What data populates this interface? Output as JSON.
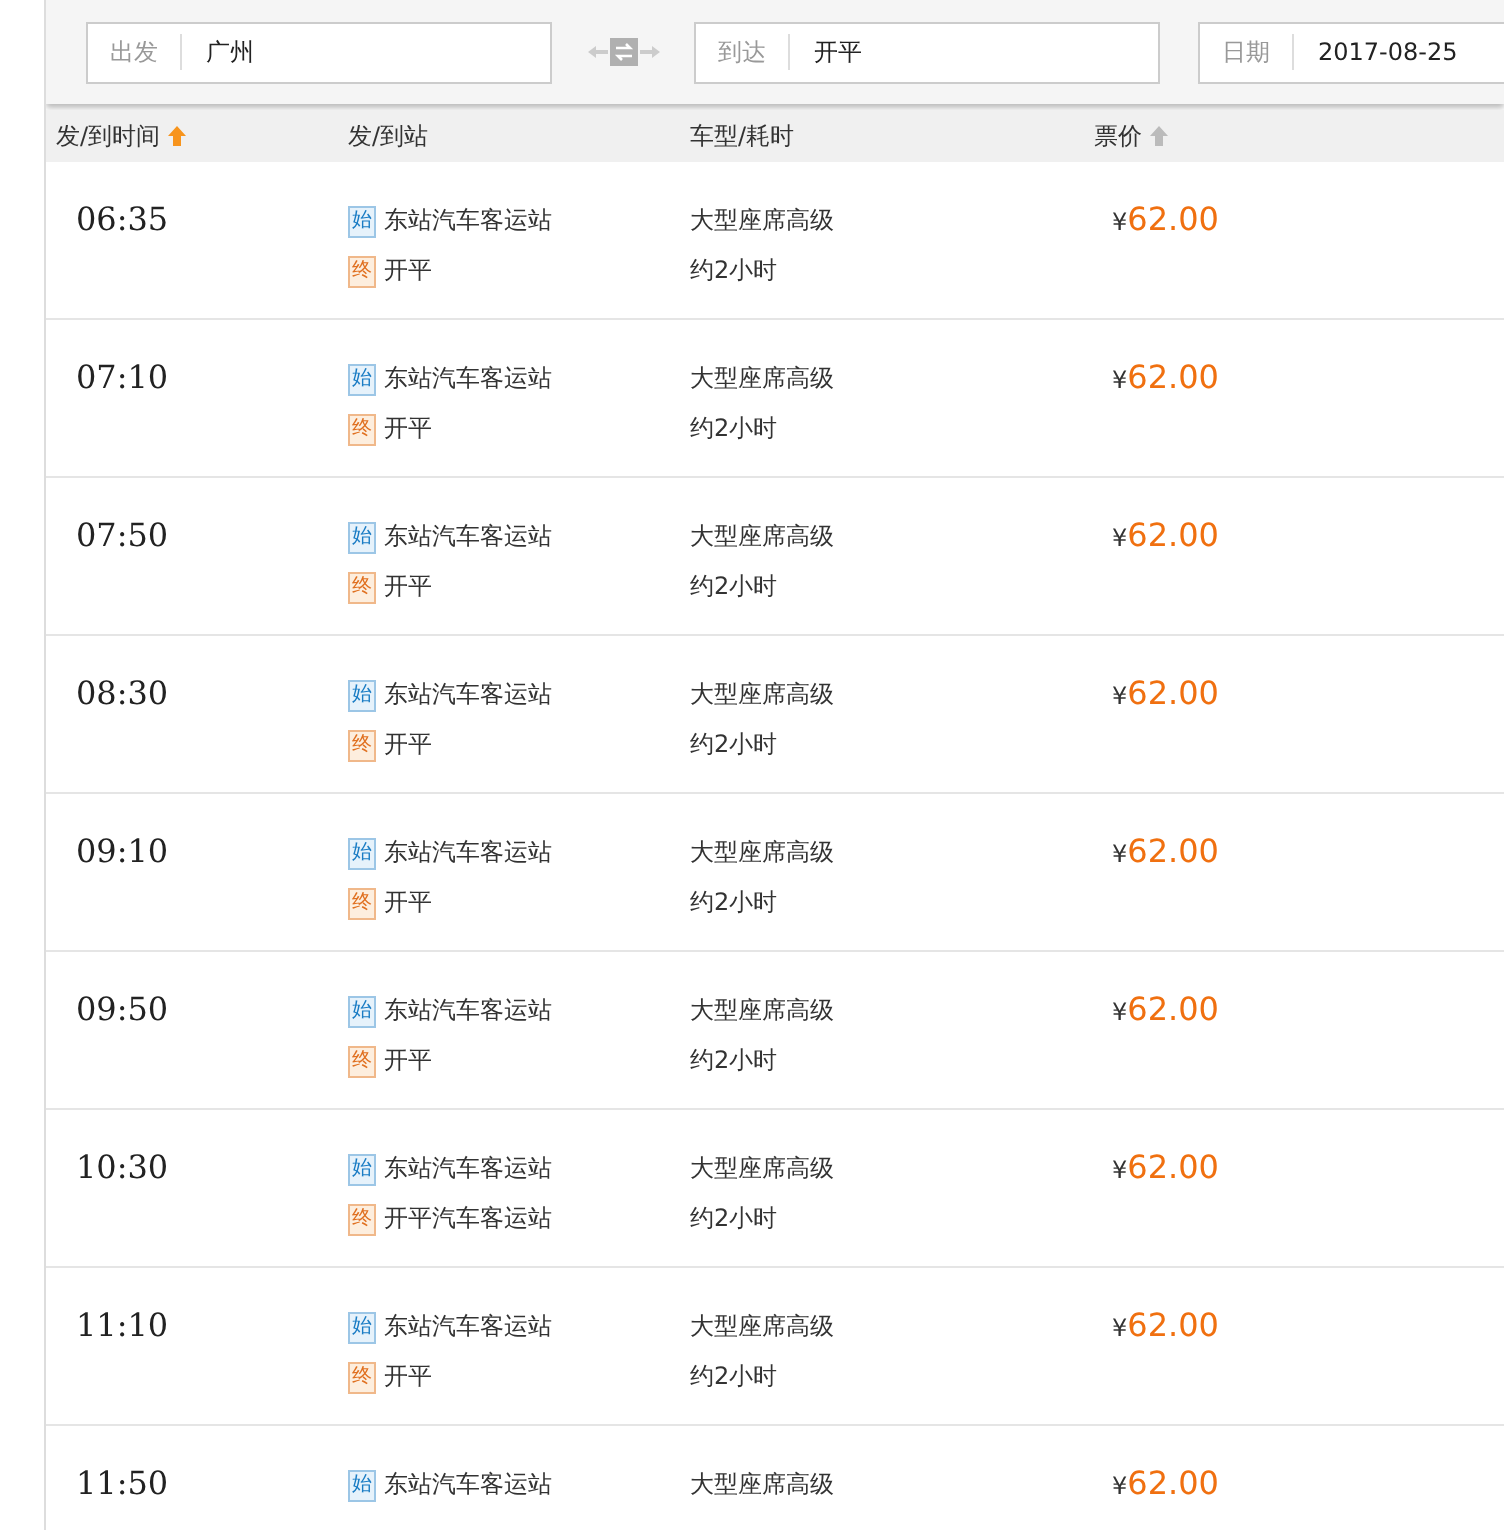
{
  "search": {
    "fields": [
      {
        "label": "出发",
        "value": "广州"
      },
      {
        "label": "到达",
        "value": "开平"
      },
      {
        "label": "日期",
        "value": "2017-08-25"
      }
    ]
  },
  "columns": [
    {
      "label": "发/到时间",
      "sortable": true,
      "sorted": true
    },
    {
      "label": "发/到站",
      "sortable": false,
      "sorted": false
    },
    {
      "label": "车型/耗时",
      "sortable": false,
      "sorted": false
    },
    {
      "label": "票价",
      "sortable": true,
      "sorted": false
    }
  ],
  "rows": [
    {
      "time": "06:35",
      "from_tag": "始",
      "from": "东站汽车客运站",
      "to_tag": "终",
      "to": "开平",
      "vehicle": "大型座席高级",
      "duration": "约2小时",
      "currency": "¥",
      "price": "62.00"
    },
    {
      "time": "07:10",
      "from_tag": "始",
      "from": "东站汽车客运站",
      "to_tag": "终",
      "to": "开平",
      "vehicle": "大型座席高级",
      "duration": "约2小时",
      "currency": "¥",
      "price": "62.00"
    },
    {
      "time": "07:50",
      "from_tag": "始",
      "from": "东站汽车客运站",
      "to_tag": "终",
      "to": "开平",
      "vehicle": "大型座席高级",
      "duration": "约2小时",
      "currency": "¥",
      "price": "62.00"
    },
    {
      "time": "08:30",
      "from_tag": "始",
      "from": "东站汽车客运站",
      "to_tag": "终",
      "to": "开平",
      "vehicle": "大型座席高级",
      "duration": "约2小时",
      "currency": "¥",
      "price": "62.00"
    },
    {
      "time": "09:10",
      "from_tag": "始",
      "from": "东站汽车客运站",
      "to_tag": "终",
      "to": "开平",
      "vehicle": "大型座席高级",
      "duration": "约2小时",
      "currency": "¥",
      "price": "62.00"
    },
    {
      "time": "09:50",
      "from_tag": "始",
      "from": "东站汽车客运站",
      "to_tag": "终",
      "to": "开平",
      "vehicle": "大型座席高级",
      "duration": "约2小时",
      "currency": "¥",
      "price": "62.00"
    },
    {
      "time": "10:30",
      "from_tag": "始",
      "from": "东站汽车客运站",
      "to_tag": "终",
      "to": "开平汽车客运站",
      "vehicle": "大型座席高级",
      "duration": "约2小时",
      "currency": "¥",
      "price": "62.00"
    },
    {
      "time": "11:10",
      "from_tag": "始",
      "from": "东站汽车客运站",
      "to_tag": "终",
      "to": "开平",
      "vehicle": "大型座席高级",
      "duration": "约2小时",
      "currency": "¥",
      "price": "62.00"
    },
    {
      "time": "11:50",
      "from_tag": "始",
      "from": "东站汽车客运站",
      "vehicle": "大型座席高级",
      "currency": "¥",
      "price": "62.00"
    }
  ]
}
